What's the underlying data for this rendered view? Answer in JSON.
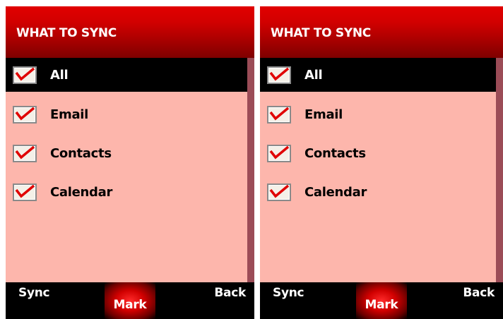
{
  "screens": [
    {
      "header_title": "WHAT TO SYNC",
      "items": [
        {
          "label": "All",
          "checked": true,
          "selected": true
        },
        {
          "label": "Email",
          "checked": true,
          "selected": false
        },
        {
          "label": "Contacts",
          "checked": true,
          "selected": false
        },
        {
          "label": "Calendar",
          "checked": true,
          "selected": false
        }
      ],
      "softkeys": {
        "left": "Sync",
        "center": "Mark",
        "right": "Back"
      }
    },
    {
      "header_title": "WHAT TO SYNC",
      "items": [
        {
          "label": "All",
          "checked": true,
          "selected": true
        },
        {
          "label": "Email",
          "checked": true,
          "selected": false
        },
        {
          "label": "Contacts",
          "checked": true,
          "selected": false
        },
        {
          "label": "Calendar",
          "checked": true,
          "selected": false
        }
      ],
      "softkeys": {
        "left": "Sync",
        "center": "Mark",
        "right": "Back"
      }
    }
  ],
  "colors": {
    "header_red": "#d20000",
    "list_background": "#fdb6ac",
    "selected_row": "#000000",
    "scrollbar": "#9b4c57",
    "check_mark": "#e00000"
  },
  "icons": {
    "checkbox": "checkbox-checked-icon"
  }
}
